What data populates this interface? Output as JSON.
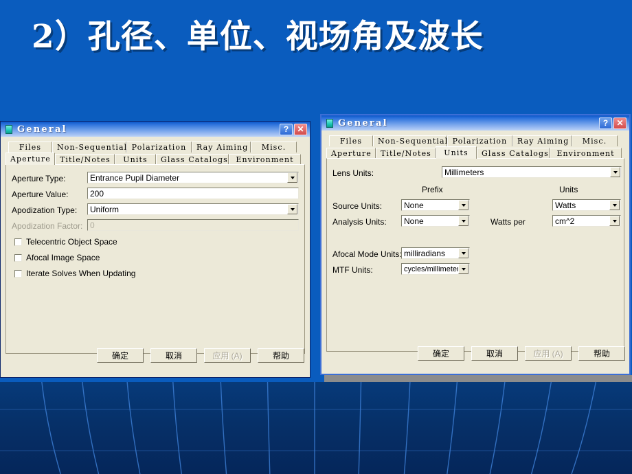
{
  "slide": {
    "title": "2）孔径、单位、视场角及波长",
    "background_color": "#0A5CBE",
    "background_bottom_color": "#063068"
  },
  "dialog_left": {
    "titlebar": {
      "text": "General",
      "icon": "lens-icon",
      "help_label": "?",
      "close_label": "✕"
    },
    "tabs_row1": [
      "Files",
      "Non-Sequential",
      "Polarization",
      "Ray Aiming",
      "Misc."
    ],
    "tabs_row2": [
      "Aperture",
      "Title/Notes",
      "Units",
      "Glass Catalogs",
      "Environment"
    ],
    "selected_tab": "Aperture",
    "fields": [
      {
        "label": "Aperture Type:",
        "value": "Entrance Pupil Diameter",
        "type": "dropdown",
        "disabled": false
      },
      {
        "label": "Aperture Value:",
        "value": "200",
        "type": "text",
        "disabled": false
      },
      {
        "label": "Apodization Type:",
        "value": "Uniform",
        "type": "dropdown",
        "disabled": false
      },
      {
        "label": "Apodization Factor:",
        "value": "0",
        "type": "text",
        "disabled": true
      }
    ],
    "checkboxes": [
      {
        "label": "Telecentric Object Space",
        "checked": false
      },
      {
        "label": "Afocal Image Space",
        "checked": false
      },
      {
        "label": "Iterate Solves When Updating",
        "checked": false
      }
    ],
    "buttons": [
      {
        "label": "确定",
        "disabled": false
      },
      {
        "label": "取消",
        "disabled": false
      },
      {
        "label": "应用 (A)",
        "disabled": true
      },
      {
        "label": "帮助",
        "disabled": false
      }
    ]
  },
  "dialog_right": {
    "titlebar": {
      "text": "General",
      "icon": "lens-icon",
      "help_label": "?",
      "close_label": "✕"
    },
    "tabs_row1": [
      "Files",
      "Non-Sequential",
      "Polarization",
      "Ray Aiming",
      "Misc."
    ],
    "tabs_row2": [
      "Aperture",
      "Title/Notes",
      "Units",
      "Glass Catalogs",
      "Environment"
    ],
    "selected_tab": "Units",
    "column_headers": {
      "prefix": "Prefix",
      "units": "Units"
    },
    "lens_units": {
      "label": "Lens Units:",
      "value": "Millimeters"
    },
    "source_units": {
      "label": "Source Units:",
      "prefix": "None",
      "units": "Watts"
    },
    "analysis_units": {
      "label": "Analysis Units:",
      "prefix": "None",
      "middle": "Watts per",
      "units": "cm^2"
    },
    "afocal_mode_units": {
      "label": "Afocal Mode Units:",
      "value": "milliradians"
    },
    "mtf_units": {
      "label": "MTF Units:",
      "value": "cycles/millimeter"
    },
    "buttons": [
      {
        "label": "确定",
        "disabled": false
      },
      {
        "label": "取消",
        "disabled": false
      },
      {
        "label": "应用 (A)",
        "disabled": true
      },
      {
        "label": "帮助",
        "disabled": false
      }
    ]
  }
}
